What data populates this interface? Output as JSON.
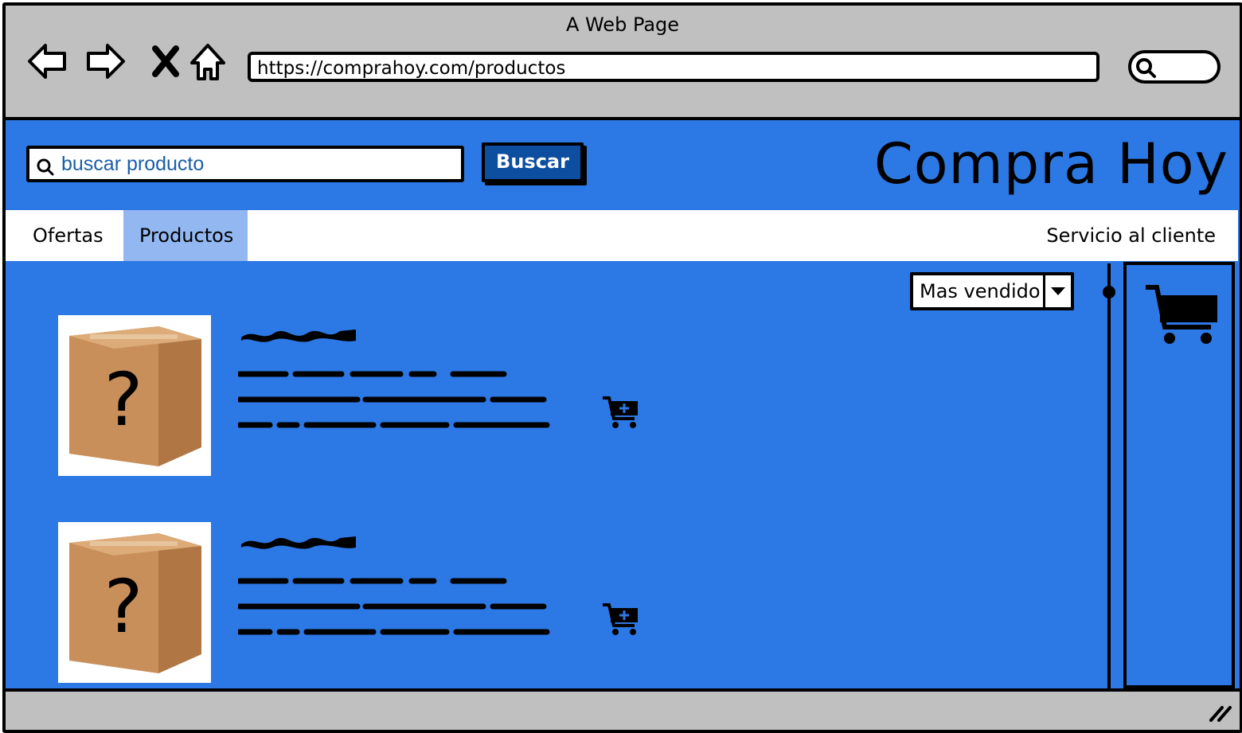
{
  "window": {
    "title": "A Web Page"
  },
  "browser": {
    "url": "https://comprahoy.com/productos"
  },
  "header": {
    "search_placeholder": "buscar producto",
    "search_button": "Buscar",
    "brand": "Compra Hoy"
  },
  "menu": {
    "items": [
      {
        "label": "Ofertas",
        "active": false
      },
      {
        "label": "Productos",
        "active": true
      }
    ],
    "right_item": "Servicio al cliente"
  },
  "sort": {
    "selected": "Mas vendido"
  },
  "products": [
    {
      "image_icon": "question-mark-box"
    },
    {
      "image_icon": "question-mark-box"
    }
  ],
  "colors": {
    "page_bg": "#2c78e4",
    "menu_active": "#93b7f1",
    "button_bg": "#0d4ea1",
    "chrome_gray": "#c0c0c0"
  }
}
